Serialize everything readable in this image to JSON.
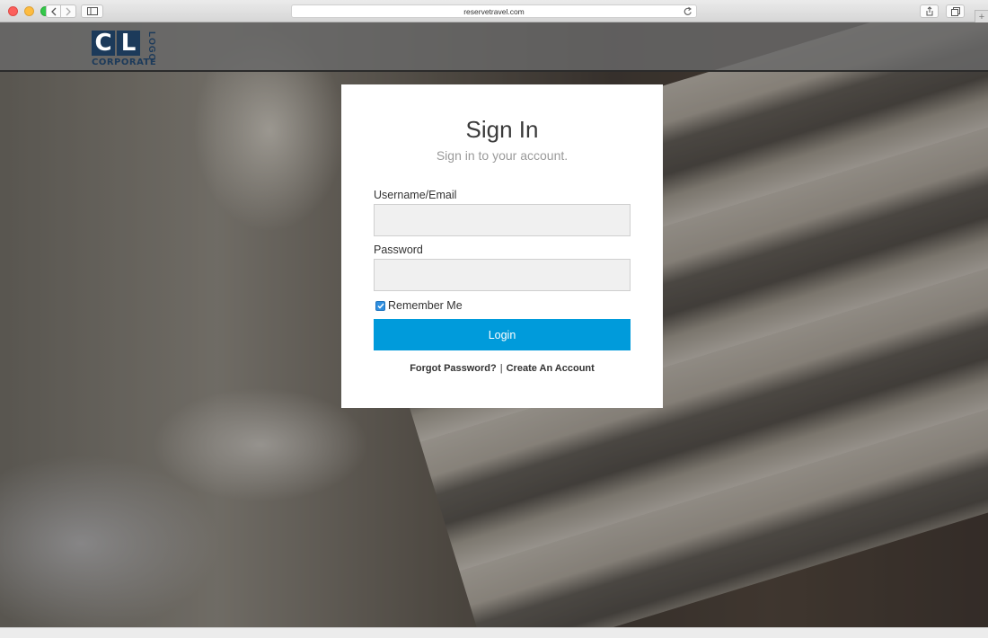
{
  "browser": {
    "url": "reservetravel.com"
  },
  "logo": {
    "letters": [
      "C",
      "L"
    ],
    "vertical_text": "LOGO",
    "company_text": "CORPORATE",
    "color": "#1c3a5a"
  },
  "signin": {
    "title": "Sign In",
    "subtitle": "Sign in to your account.",
    "username_label": "Username/Email",
    "username_value": "",
    "password_label": "Password",
    "password_value": "",
    "remember_label": "Remember Me",
    "remember_checked": true,
    "login_label": "Login",
    "forgot_label": "Forgot Password?",
    "separator": "|",
    "create_label": "Create An Account",
    "button_color": "#009bdb"
  }
}
